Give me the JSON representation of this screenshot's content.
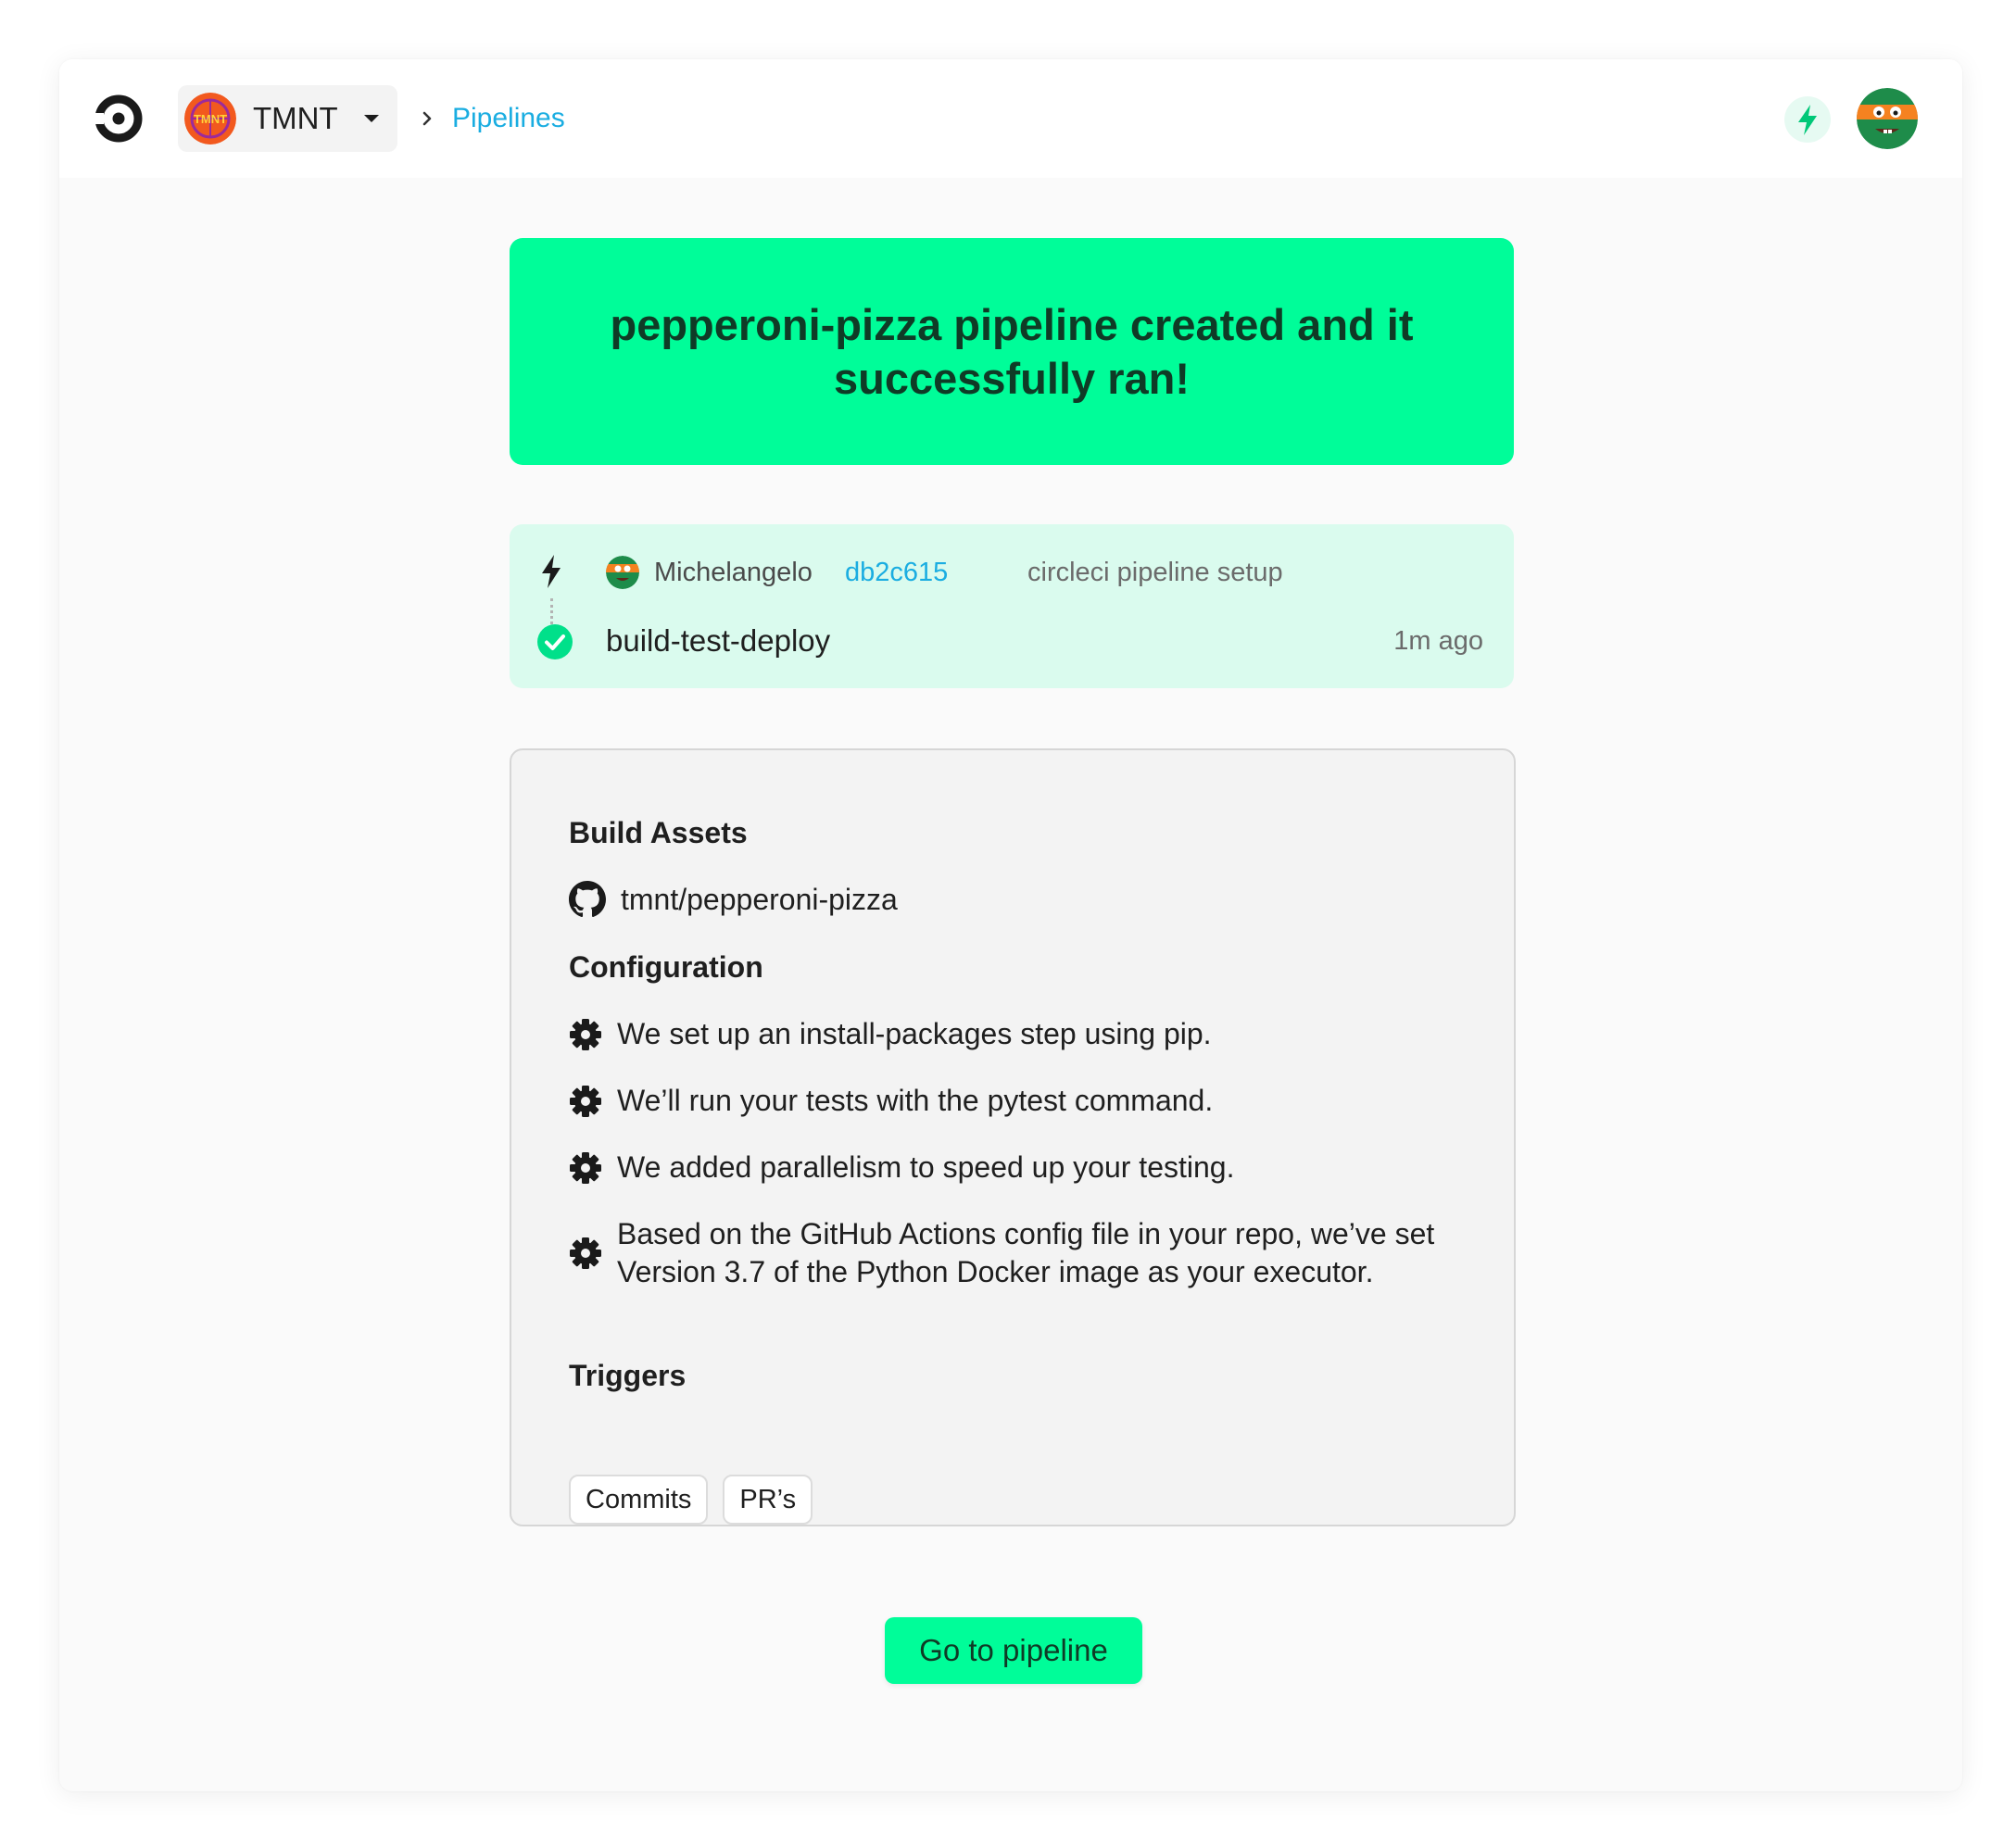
{
  "header": {
    "org_name": "TMNT",
    "org_avatar_text": "TMNT",
    "breadcrumb": "Pipelines"
  },
  "banner": {
    "message": "pepperoni-pizza pipeline created and it successfully ran!"
  },
  "run": {
    "author": "Michelangelo",
    "commit_hash": "db2c615",
    "commit_message": "circleci pipeline setup",
    "workflow": "build-test-deploy",
    "time": "1m ago",
    "status": "success"
  },
  "details": {
    "build_assets_title": "Build Assets",
    "repo": "tmnt/pepperoni-pizza",
    "configuration_title": "Configuration",
    "configuration_items": [
      "We set up an install-packages step using pip.",
      "We’ll run your tests with the pytest command.",
      "We added parallelism to speed up your testing.",
      "Based on the GitHub Actions config file in your repo, we’ve set Version 3.7 of the Python Docker image as your executor."
    ],
    "triggers_title": "Triggers",
    "triggers": [
      "Commits",
      "PR’s"
    ]
  },
  "cta": {
    "label": "Go to pipeline"
  },
  "colors": {
    "accent": "#00fd99",
    "banner_text": "#0f3b26",
    "run_card_bg": "#dafbee",
    "link": "#1aade1"
  },
  "icons": {
    "logo": "circleci-logo-icon",
    "caret": "caret-down-icon",
    "chevron": "chevron-right-icon",
    "bolt": "bolt-icon",
    "check": "check-circle-icon",
    "github": "github-icon",
    "gear": "gear-icon"
  }
}
